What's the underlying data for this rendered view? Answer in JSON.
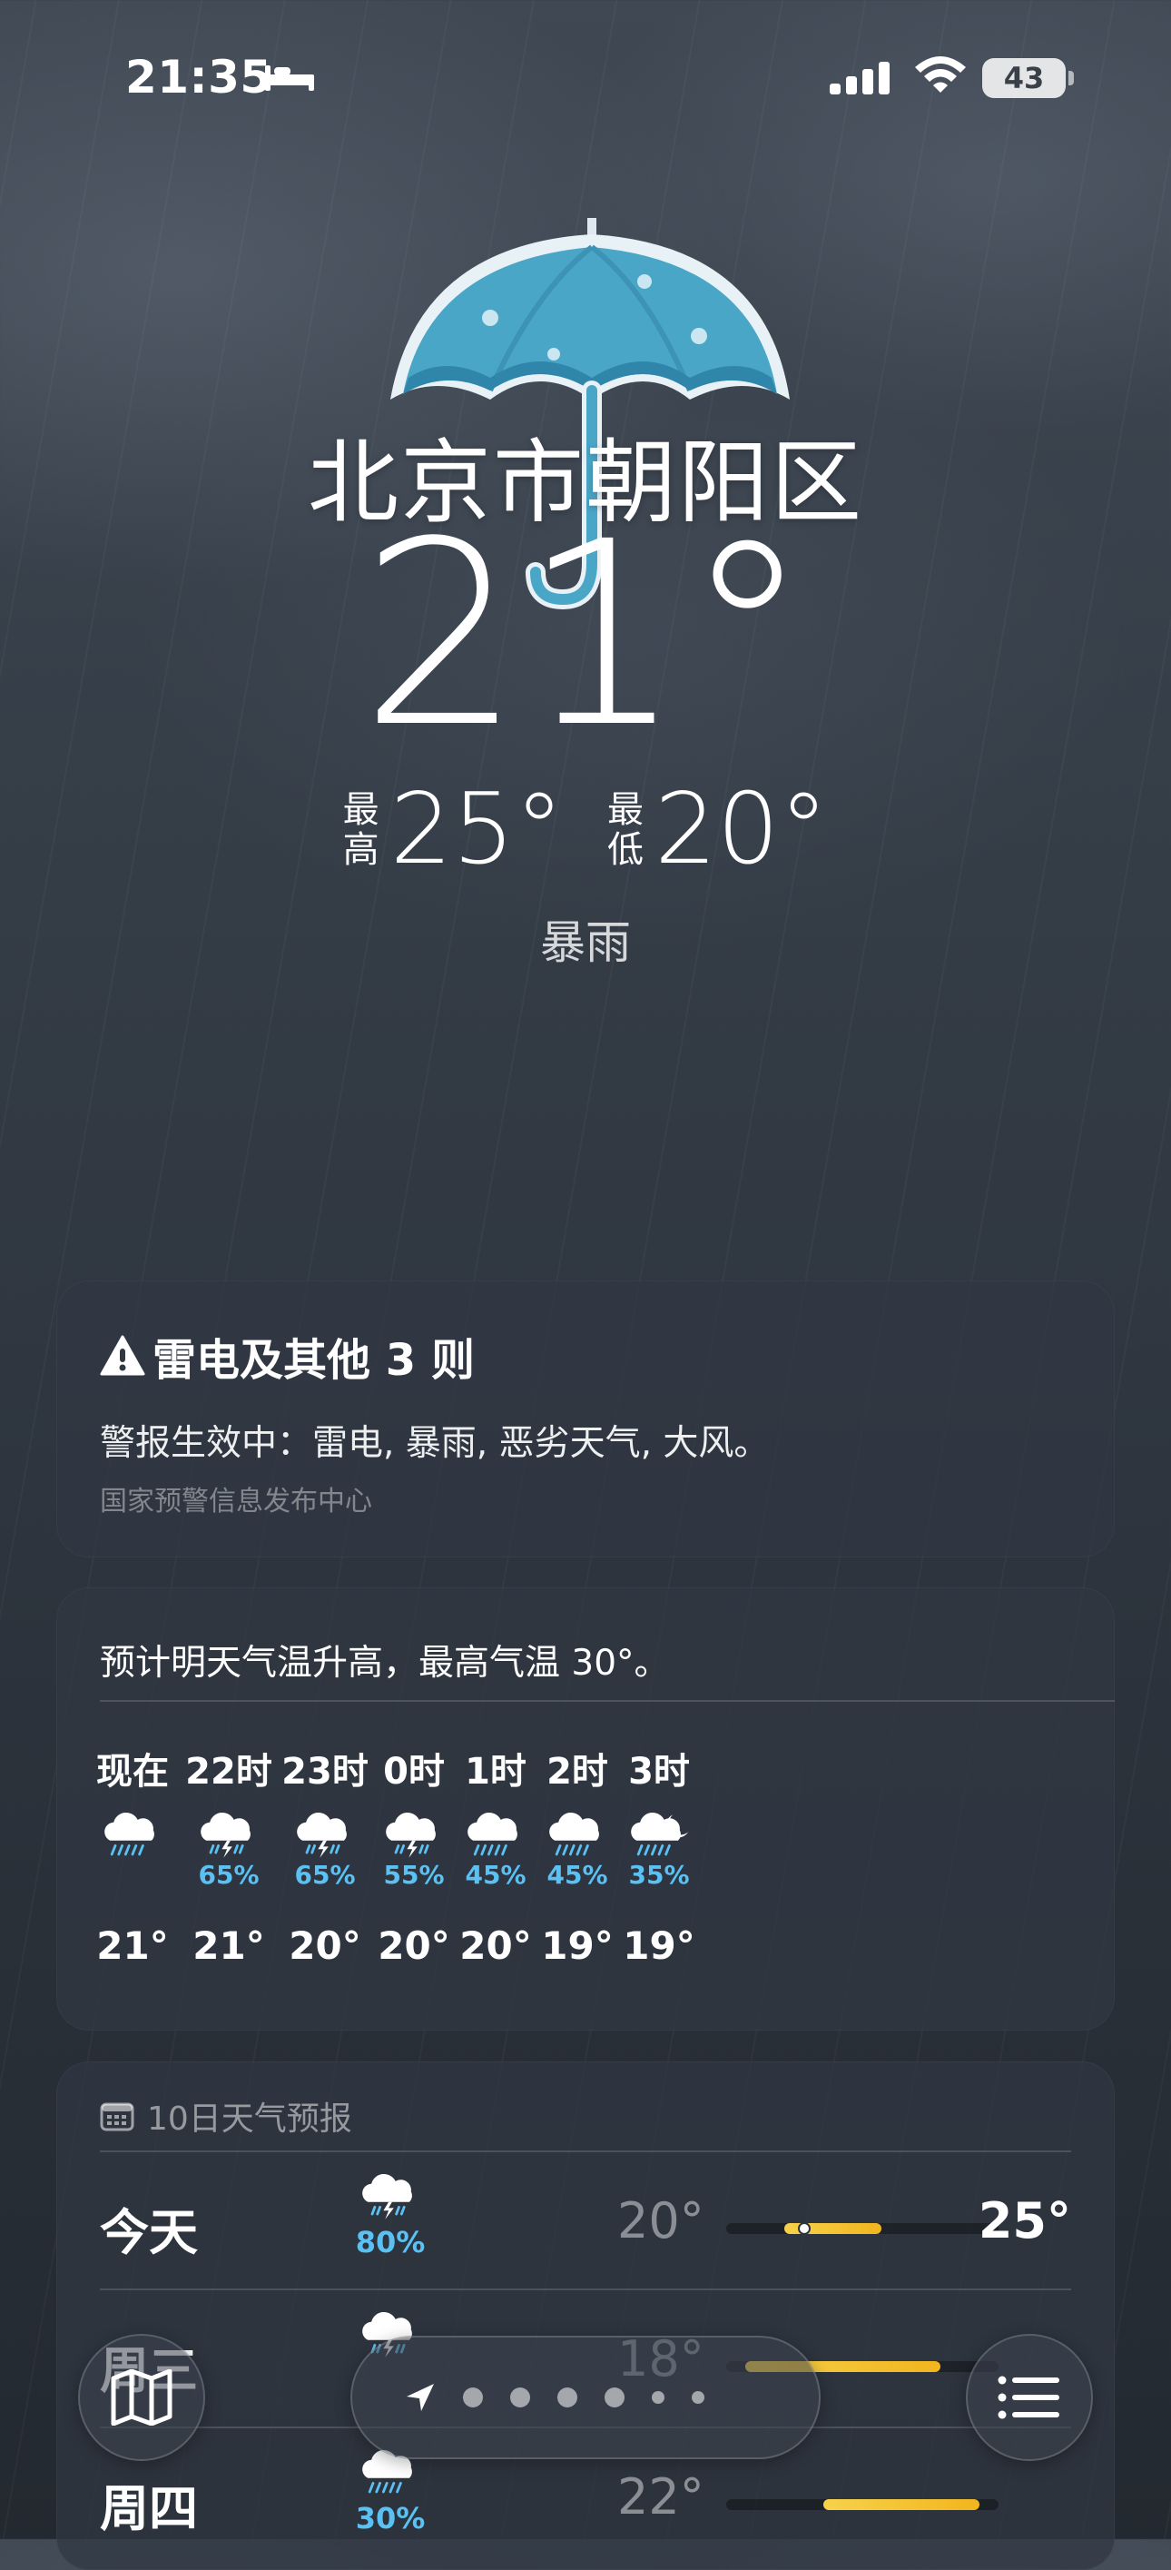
{
  "status_bar": {
    "time": "21:35",
    "battery": "43",
    "icons": [
      "bed-icon",
      "cellular-signal-icon",
      "wifi-icon",
      "battery-icon"
    ]
  },
  "hero": {
    "location": "北京市朝阳区",
    "temperature": "21°",
    "high_label_1": "最",
    "high_label_2": "高",
    "high_value": "25°",
    "low_label_1": "最",
    "low_label_2": "低",
    "low_value": "20°",
    "condition": "暴雨",
    "icon": "umbrella-icon"
  },
  "alert": {
    "title": "雷电及其他 3 则",
    "body": "警报生效中：雷电, 暴雨, 恶劣天气, 大风。",
    "source": "国家预警信息发布中心",
    "icon": "warning-triangle-icon"
  },
  "hourly": {
    "summary": "预计明天气温升高，最高气温 30°。",
    "hours": [
      {
        "label": "现在",
        "icon": "cloud-rain-icon",
        "pct": "",
        "temp": "21°"
      },
      {
        "label": "22时",
        "icon": "cloud-thunder-rain-icon",
        "pct": "65%",
        "temp": "21°"
      },
      {
        "label": "23时",
        "icon": "cloud-thunder-rain-icon",
        "pct": "65%",
        "temp": "20°"
      },
      {
        "label": "0时",
        "icon": "cloud-thunder-rain-icon",
        "pct": "55%",
        "temp": "20°"
      },
      {
        "label": "1时",
        "icon": "cloud-rain-icon",
        "pct": "45%",
        "temp": "20°"
      },
      {
        "label": "2时",
        "icon": "cloud-rain-icon",
        "pct": "45%",
        "temp": "19°"
      },
      {
        "label": "3时",
        "icon": "cloud-moon-rain-icon",
        "pct": "35%",
        "temp": "19°"
      }
    ]
  },
  "daily": {
    "header": "10日天气预报",
    "header_icon": "calendar-icon",
    "days": [
      {
        "name": "今天",
        "icon": "cloud-thunder-rain-icon",
        "pct": "80%",
        "low": "20°",
        "high": "25°",
        "range_low": 20,
        "range_high": 25,
        "current": 21
      },
      {
        "name": "周三",
        "icon": "cloud-thunder-rain-icon",
        "pct": "",
        "low": "18°",
        "high": "",
        "range_low": 18,
        "range_high": 28,
        "current": null
      },
      {
        "name": "周四",
        "icon": "cloud-rain-icon",
        "pct": "30%",
        "low": "22°",
        "high": "",
        "range_low": 22,
        "range_high": 30,
        "current": null
      }
    ],
    "scale_min": 17,
    "scale_max": 31
  },
  "toolbar": {
    "map_icon": "map-icon",
    "location_icon": "location-arrow-icon",
    "list_icon": "list-icon",
    "page_dots": 6,
    "current_page": 0
  },
  "colors": {
    "precip_blue": "#5bc1f2",
    "temp_bar_yellow": "#f2b51f"
  }
}
